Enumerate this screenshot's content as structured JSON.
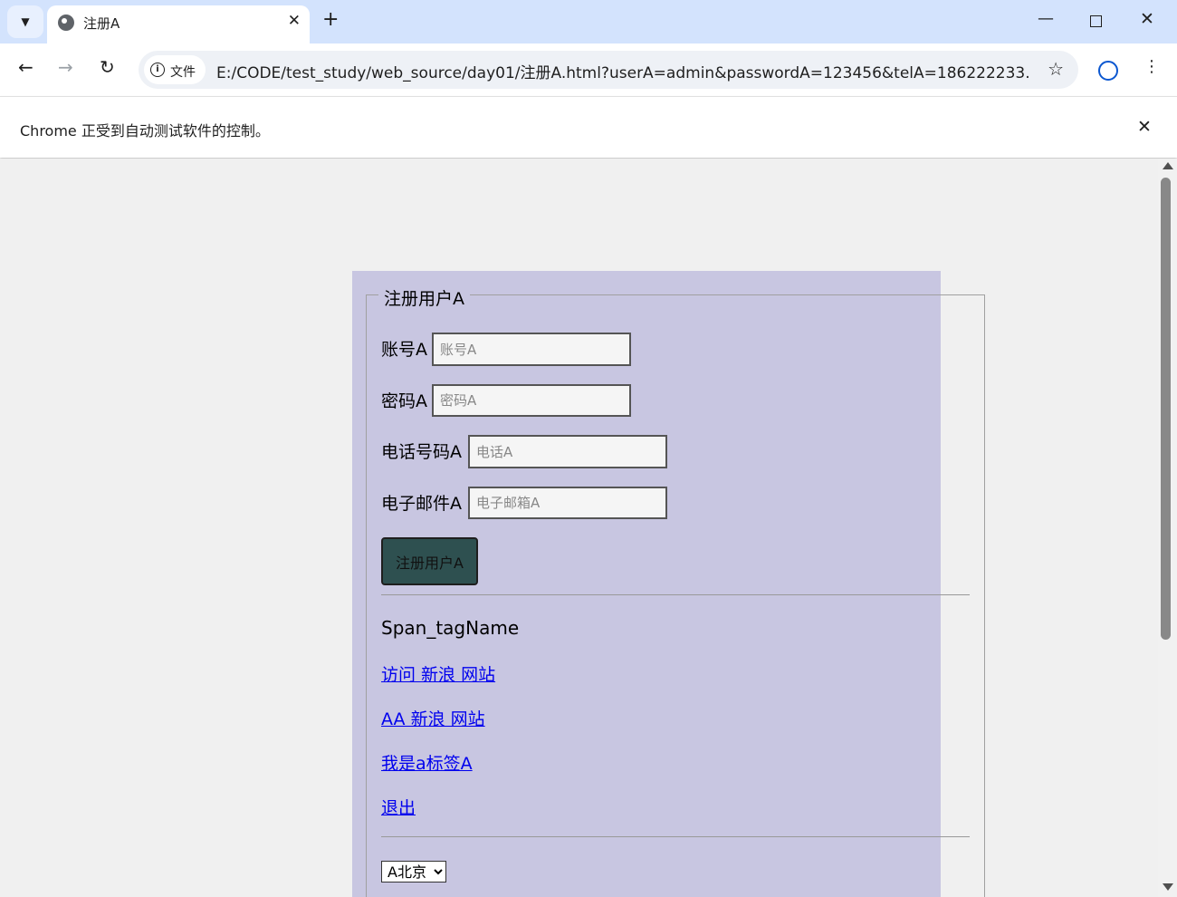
{
  "tab": {
    "title": "注册A",
    "close_glyph": "✕"
  },
  "window": {
    "new_tab_glyph": "+",
    "minimize_glyph": "—",
    "close_glyph": "✕"
  },
  "toolbar": {
    "back_glyph": "←",
    "forward_glyph": "→",
    "reload_glyph": "↻",
    "security_chip_label": "文件",
    "url": "E:/CODE/test_study/web_source/day01/注册A.html?userA=admin&passwordA=123456&telA=186222233...",
    "star_glyph": "☆",
    "menu_glyph": "⋮"
  },
  "infobar": {
    "text": "Chrome 正受到自动测试软件的控制。",
    "close_glyph": "✕"
  },
  "form": {
    "legend": "注册用户A",
    "fields": [
      {
        "label": "账号A",
        "placeholder": "账号A"
      },
      {
        "label": "密码A",
        "placeholder": "密码A"
      },
      {
        "label": "电话号码A",
        "placeholder": "电话A"
      },
      {
        "label": "电子邮件A",
        "placeholder": "电子邮箱A"
      }
    ],
    "submit_label": "注册用户A"
  },
  "content": {
    "span_text": "Span_tagName",
    "links": [
      "访问 新浪 网站",
      "AA 新浪 网站",
      "我是a标签A",
      "退出"
    ],
    "select_value": "A北京"
  },
  "icons": [
    "chevron-down-icon",
    "globe-icon",
    "close-icon",
    "plus-icon",
    "minimize-icon",
    "maximize-icon",
    "back-icon",
    "forward-icon",
    "reload-icon",
    "info-icon",
    "star-icon",
    "profile-icon",
    "menu-icon"
  ]
}
